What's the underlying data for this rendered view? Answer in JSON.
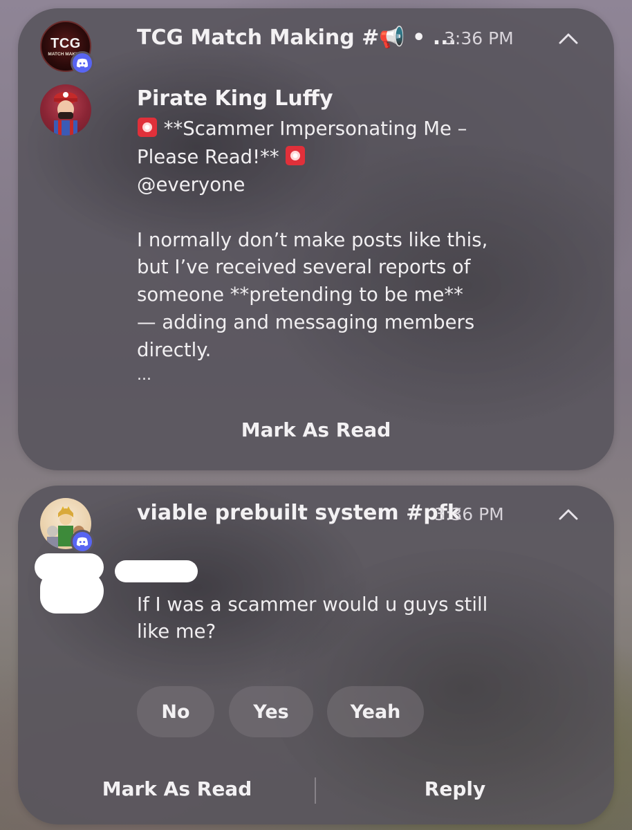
{
  "notifications": [
    {
      "title": "TCG Match Making #📢 • ...",
      "time": "3:36 PM",
      "server_avatar_text": "TCG",
      "server_avatar_subtext": "MATCH MAKING",
      "icon": "chevron-up-icon",
      "sender": "Pirate King Luffy",
      "message_lines": [
        "**Scammer Impersonating Me –",
        "Please Read!**",
        "@everyone",
        "I normally don’t make posts like this,",
        "but I’ve received several reports of",
        "someone **pretending to be me**",
        "— adding and messaging members",
        "directly.",
        "..."
      ],
      "mark_read_label": "Mark As Read"
    },
    {
      "title": "viable prebuilt system #pfk",
      "time": "3:36 PM",
      "icon": "chevron-up-icon",
      "message_lines": [
        "If I was a scammer would u guys still",
        "like me?"
      ],
      "quick_replies": [
        "No",
        "Yes",
        "Yeah"
      ],
      "mark_read_label": "Mark As Read",
      "reply_label": "Reply"
    }
  ],
  "colors": {
    "discord_blurple": "#5865f2",
    "card_background": "#58545c",
    "siren_red": "#e0303a"
  }
}
